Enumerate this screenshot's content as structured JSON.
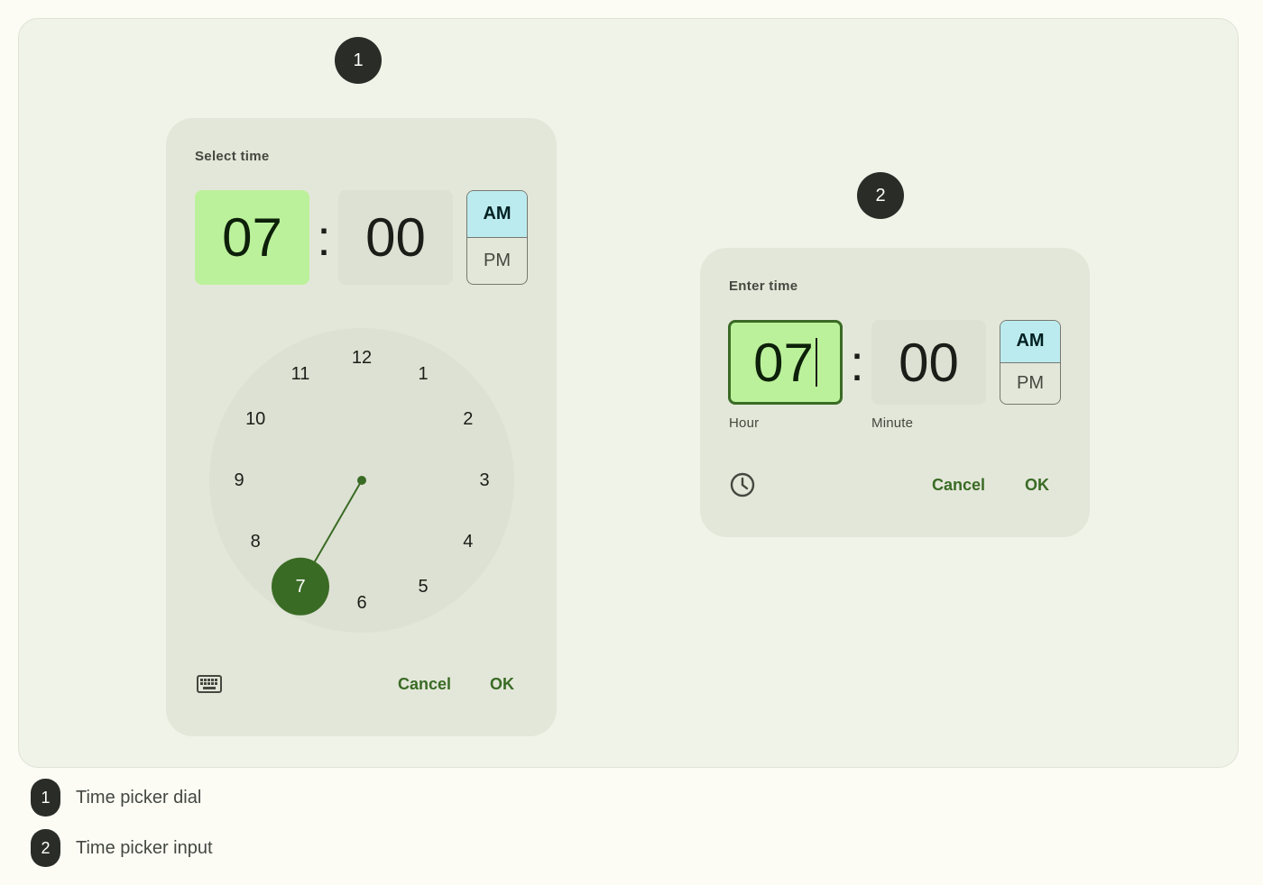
{
  "markers": {
    "dial": "1",
    "input": "2"
  },
  "dial_picker": {
    "title": "Select time",
    "hour": "07",
    "minute": "00",
    "separator": ":",
    "am": "AM",
    "pm": "PM",
    "selected_period": "AM",
    "clock_numbers": [
      "12",
      "1",
      "2",
      "3",
      "4",
      "5",
      "6",
      "7",
      "8",
      "9",
      "10",
      "11"
    ],
    "selected_hour": 7,
    "mode_icon": "keyboard-icon",
    "cancel": "Cancel",
    "ok": "OK"
  },
  "input_picker": {
    "title": "Enter time",
    "hour": "07",
    "minute": "00",
    "separator": ":",
    "hour_label": "Hour",
    "minute_label": "Minute",
    "am": "AM",
    "pm": "PM",
    "selected_period": "AM",
    "mode_icon": "clock-icon",
    "cancel": "Cancel",
    "ok": "OK"
  },
  "legend": [
    {
      "number": "1",
      "label": "Time picker dial"
    },
    {
      "number": "2",
      "label": "Time picker input"
    }
  ],
  "colors": {
    "primary": "#3a6b25",
    "selected_field": "#bcf19b",
    "selected_period": "#bcebef",
    "surface": "#e3e7d9",
    "marker": "#2a2d27"
  }
}
